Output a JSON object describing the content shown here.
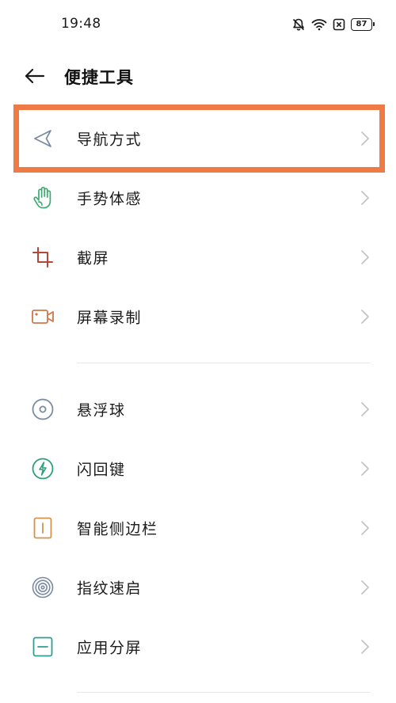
{
  "status_bar": {
    "time": "19:48",
    "battery": "87"
  },
  "header": {
    "title": "便捷工具",
    "back_icon": "arrow-left-icon"
  },
  "group1": [
    {
      "label": "导航方式",
      "icon": "navigation-arrow-icon",
      "icon_color": "#7a8aa0"
    },
    {
      "label": "手势体感",
      "icon": "hand-gesture-icon",
      "icon_color": "#3daa6f"
    },
    {
      "label": "截屏",
      "icon": "crop-icon",
      "icon_color": "#b5473a"
    },
    {
      "label": "屏幕录制",
      "icon": "video-camera-icon",
      "icon_color": "#d0774a"
    }
  ],
  "group2": [
    {
      "label": "悬浮球",
      "icon": "floating-ball-icon",
      "icon_color": "#7a8aa0"
    },
    {
      "label": "闪回键",
      "icon": "flashback-icon",
      "icon_color": "#2f9e7a"
    },
    {
      "label": "智能侧边栏",
      "icon": "sidebar-icon",
      "icon_color": "#d4924a"
    },
    {
      "label": "指纹速启",
      "icon": "fingerprint-icon",
      "icon_color": "#7a8aa0"
    },
    {
      "label": "应用分屏",
      "icon": "split-screen-icon",
      "icon_color": "#2f9e8f"
    }
  ],
  "colors": {
    "highlight_border": "#ee7a45",
    "chevron": "#c4c4c4",
    "divider": "#e6e6e6"
  }
}
